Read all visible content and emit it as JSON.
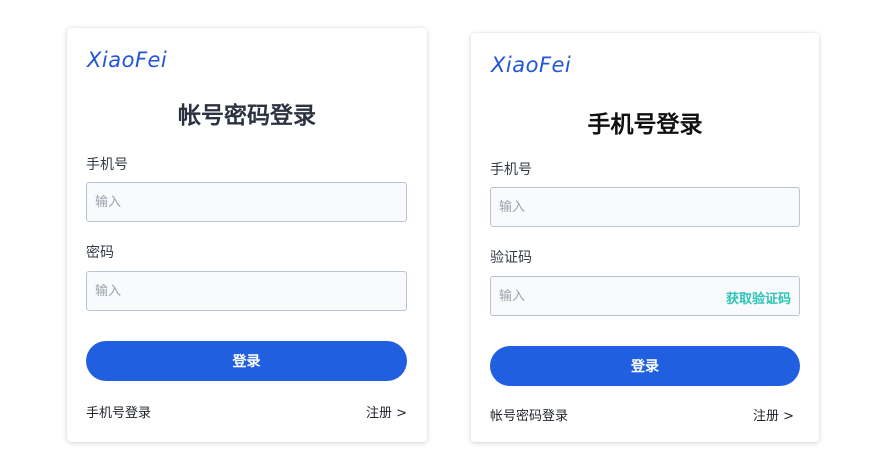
{
  "left_card": {
    "logo": "XiaoFei",
    "title": "帐号密码登录",
    "phone_label": "手机号",
    "phone_placeholder": "输入",
    "password_label": "密码",
    "password_placeholder": "输入",
    "login_button": "登录",
    "switch_link": "手机号登录",
    "register_link": "注册 >"
  },
  "right_card": {
    "logo": "XiaoFei",
    "title": "手机号登录",
    "phone_label": "手机号",
    "phone_placeholder": "输入",
    "code_label": "验证码",
    "code_placeholder": "输入",
    "get_code_link": "获取验证码",
    "login_button": "登录",
    "switch_link": "帐号密码登录",
    "register_link": "注册 >"
  },
  "colors": {
    "brand": "#2255d6",
    "button": "#1f5fe0",
    "code_link": "#2ec4b6"
  }
}
